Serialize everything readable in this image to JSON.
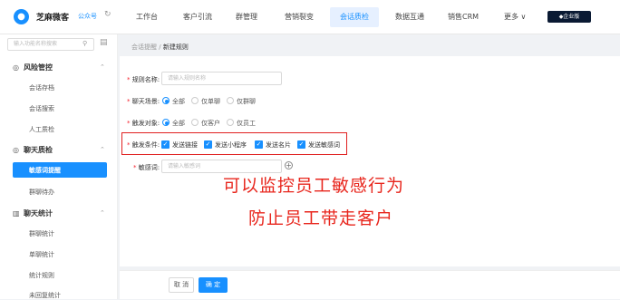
{
  "header": {
    "logo_icon": "chat-bubble-icon",
    "brand": "芝麻微客",
    "brand_tag": "公众号",
    "switch_icon": "refresh-icon",
    "nav": [
      "工作台",
      "客户引流",
      "群管理",
      "营销裂变",
      "会话质检",
      "数据互通",
      "销售CRM",
      "更多 ∨"
    ],
    "active_nav": "会话质检",
    "badge": "◆企业版"
  },
  "sidebar": {
    "search_placeholder": "输入功能名称搜索",
    "groups": [
      {
        "title": "风险管控",
        "icon": "radar-icon",
        "items": [
          "会话存档",
          "会话搜索",
          "人工质检"
        ]
      },
      {
        "title": "聊天质检",
        "icon": "radar-icon",
        "items": [
          "敏感词提醒",
          "群聊待办"
        ],
        "active_item": "敏感词提醒"
      },
      {
        "title": "聊天统计",
        "icon": "chart-icon",
        "items": [
          "群聊统计",
          "单聊统计",
          "统计规则",
          "未回复统计"
        ]
      }
    ]
  },
  "breadcrumb": {
    "parent": "会话提醒",
    "separator": "/",
    "current": "新建规则"
  },
  "form": {
    "rule_name": {
      "label": "规则名称:",
      "placeholder": "请输入规则名称"
    },
    "chat_scene": {
      "label": "聊天场景:",
      "options": [
        "全部",
        "仅单聊",
        "仅群聊"
      ],
      "selected": "全部"
    },
    "trigger_target": {
      "label": "触发对象:",
      "options": [
        "全部",
        "仅客户",
        "仅员工"
      ],
      "selected": "全部"
    },
    "trigger_condition": {
      "label": "触发条件:",
      "options": [
        "发送链接",
        "发送小程序",
        "发送名片",
        "发送敏感词"
      ]
    },
    "sensitive_word": {
      "label": "敏感词:",
      "placeholder": "请输入敏感词"
    }
  },
  "overlay_text": [
    "可以监控员工敏感行为",
    "防止员工带走客户"
  ],
  "footer": {
    "cancel": "取 消",
    "confirm": "确 定"
  },
  "colors": {
    "accent": "#1890ff",
    "highlight": "#e02020"
  }
}
